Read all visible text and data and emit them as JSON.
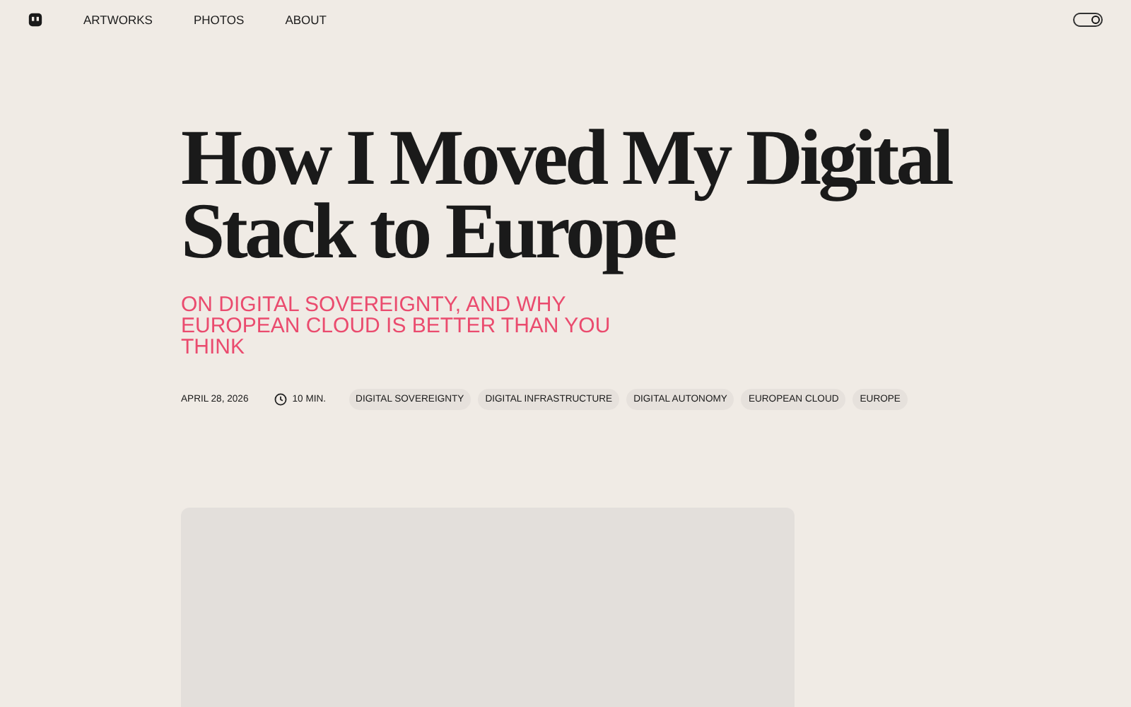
{
  "nav": {
    "links": [
      "ARTWORKS",
      "PHOTOS",
      "ABOUT"
    ],
    "theme_toggle": {
      "on": true
    }
  },
  "article": {
    "title": "How I Moved My Digital Stack to Europe",
    "subtitle": "ON DIGITAL SOVEREIGNTY, AND WHY EUROPEAN CLOUD IS BETTER THAN YOU THINK",
    "date": "APRIL 28, 2026",
    "read_time": "10 MIN.",
    "tags": [
      "DIGITAL SOVEREIGNTY",
      "DIGITAL INFRASTRUCTURE",
      "DIGITAL AUTONOMY",
      "EUROPEAN CLOUD",
      "EUROPE"
    ]
  }
}
